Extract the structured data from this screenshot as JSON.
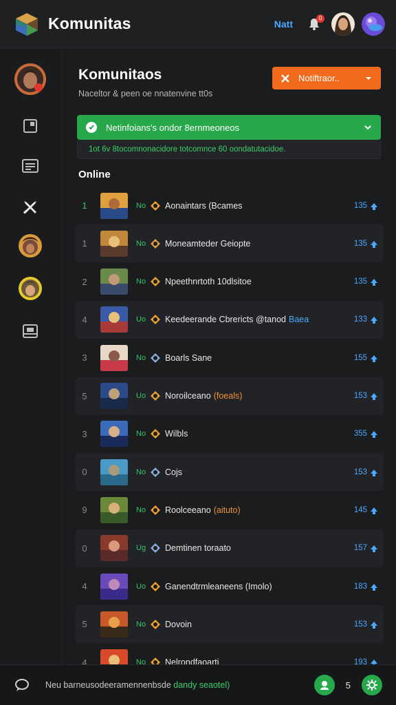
{
  "header": {
    "title": "Komunitas",
    "link_label": "Natt",
    "bell_badge": "0"
  },
  "main": {
    "title": "Komunitaos",
    "subtitle": "Naceltor &  peen oe nnatenvine  tt0s",
    "notif_button": "Notiftraor..",
    "green_banner": "Netinfoians's ondor  8ernmeoneos",
    "sub_banner": "1ot  6v    8tocomnonacidore  totcomnce   60   oondatutacidoe.",
    "section_label": "Online"
  },
  "rows": [
    {
      "rank": "1",
      "lvl": "No",
      "name": "Aonaintars (Bcames",
      "tag": "",
      "count": "135"
    },
    {
      "rank": "1",
      "lvl": "No",
      "name": "Moneamteder Geiopte",
      "tag": "",
      "count": "135"
    },
    {
      "rank": "2",
      "lvl": "No",
      "name": "Npeethnrtoth 10dlsitoe",
      "tag": "",
      "count": "135"
    },
    {
      "rank": "4",
      "lvl": "Uo",
      "name": "Keedeerande Cbrericts @tanod",
      "tag": "Baea",
      "count": "133"
    },
    {
      "rank": "3",
      "lvl": "No",
      "name": "Boarls Sane",
      "tag": "",
      "count": "155"
    },
    {
      "rank": "5",
      "lvl": "Uo",
      "name": "Noroilceano",
      "tag": "(foeals)",
      "count": "153"
    },
    {
      "rank": "3",
      "lvl": "No",
      "name": "Wilbls",
      "tag": "",
      "count": "355"
    },
    {
      "rank": "0",
      "lvl": "No",
      "name": "Cojs",
      "tag": "",
      "count": "153"
    },
    {
      "rank": "9",
      "lvl": "No",
      "name": "Roolceeano",
      "tag": "(aituto)",
      "count": "145"
    },
    {
      "rank": "0",
      "lvl": "Ug",
      "name": "Demtinen toraato",
      "tag": "",
      "count": "157"
    },
    {
      "rank": "4",
      "lvl": "Uo",
      "name": "Ganendtrmleaneens (Imolo)",
      "tag": "",
      "count": "183"
    },
    {
      "rank": "5",
      "lvl": "No",
      "name": "Dovoin",
      "tag": "",
      "count": "153"
    },
    {
      "rank": "4",
      "lvl": "No",
      "name": "Nelrondfaoarti",
      "tag": "",
      "count": "193"
    }
  ],
  "bottom": {
    "text": "Neu barneusodeeramennenbsde",
    "text_green": "dandy seaotel)",
    "count": "5"
  },
  "colors": {
    "accent_orange": "#f26a1b",
    "accent_green": "#27a84a",
    "accent_blue": "#4aa8ff"
  }
}
